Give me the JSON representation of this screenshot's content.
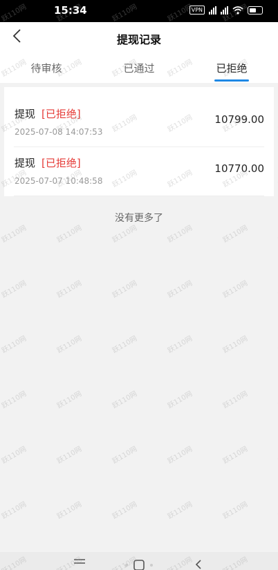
{
  "status_bar": {
    "time": "15:34",
    "vpn": "VPN"
  },
  "header": {
    "title": "提现记录"
  },
  "tabs": [
    {
      "label": "待审核",
      "active": false
    },
    {
      "label": "已通过",
      "active": false
    },
    {
      "label": "已拒绝",
      "active": true
    }
  ],
  "records": [
    {
      "type": "提现",
      "status": "[已拒绝]",
      "time": "2025-07-08 14:07:53",
      "amount": "10799.00"
    },
    {
      "type": "提现",
      "status": "[已拒绝]",
      "time": "2025-07-07 10:48:58",
      "amount": "10770.00"
    }
  ],
  "footer": {
    "no_more": "没有更多了"
  },
  "watermark": {
    "text": "跃110网"
  },
  "colors": {
    "accent": "#1e88e5",
    "rejected": "#e53935",
    "background": "#f2f2f2"
  },
  "icons": {
    "back": "back-arrow-icon",
    "menu": "menu-icon",
    "home": "home-icon",
    "return": "return-icon"
  }
}
